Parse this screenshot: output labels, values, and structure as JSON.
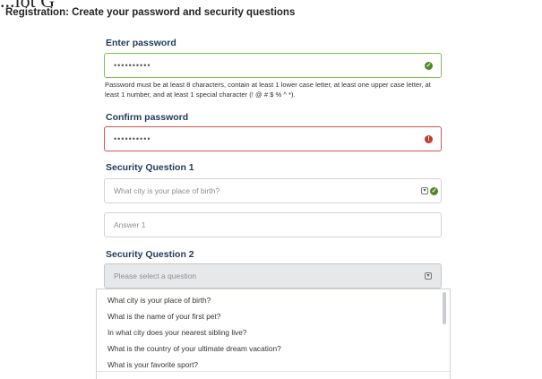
{
  "cropped_top_text": "...lot G",
  "page_title": "Registration: Create your password and security questions",
  "password": {
    "label": "Enter password",
    "value": "••••••••••",
    "status": "valid",
    "help_text": "Password must be at least 8 characters, contain at least 1 lower case letter, at least one upper case letter, at least 1 number, and at least 1 special character (! @ # $ % ^ *)."
  },
  "confirm_password": {
    "label": "Confirm password",
    "value": "••••••••••",
    "status": "invalid"
  },
  "security_question_1": {
    "label": "Security Question 1",
    "selected": "What city is your place of birth?",
    "status": "valid",
    "answer_placeholder": "Answer 1"
  },
  "security_question_2": {
    "label": "Security Question 2",
    "placeholder": "Please select a question",
    "options": [
      "What city is your place of birth?",
      "What is the name of your first pet?",
      "In what city does your nearest sibling live?",
      "What is the country of your ultimate dream vacation?",
      "What is your favorite sport?"
    ]
  },
  "colors": {
    "valid": "#4b8a26",
    "invalid": "#c23a34",
    "label": "#1f3a5c"
  },
  "icons": {
    "valid": "check-circle-icon",
    "invalid": "alert-circle-icon",
    "select": "chevron-down-icon"
  }
}
